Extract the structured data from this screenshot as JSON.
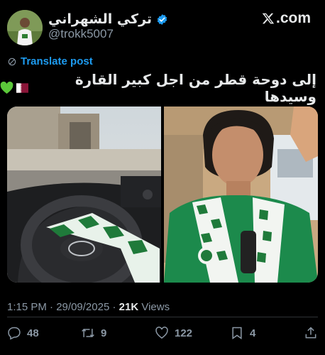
{
  "author": {
    "display_name": "تركي الشهراني",
    "handle": "@trokk5007",
    "verified_icon": "verified-badge-icon",
    "avatar": "avatar-photo"
  },
  "brand": {
    "logo": "x-logo-icon",
    "domain": ".com"
  },
  "translate": {
    "icon": "translate-icon",
    "label": "Translate post"
  },
  "post": {
    "text": "إلى دوحة قطر من اجل كبير القارة وسيدها",
    "emojis": [
      "qatar-flag",
      "green-heart"
    ]
  },
  "media": [
    {
      "name": "car-dashboard-photo"
    },
    {
      "name": "selfie-photo"
    }
  ],
  "meta": {
    "time": "1:15 PM",
    "separator": " · ",
    "date": "29/09/2025",
    "views_count": "21K",
    "views_label": " Views"
  },
  "actions": {
    "reply": "48",
    "repost": "9",
    "like": "122",
    "bookmark": "4"
  },
  "colors": {
    "link": "#1d9bf0",
    "muted": "#8b98a5",
    "text": "#e7e9ea",
    "background": "#000000",
    "verified": "#1d9bf0"
  }
}
